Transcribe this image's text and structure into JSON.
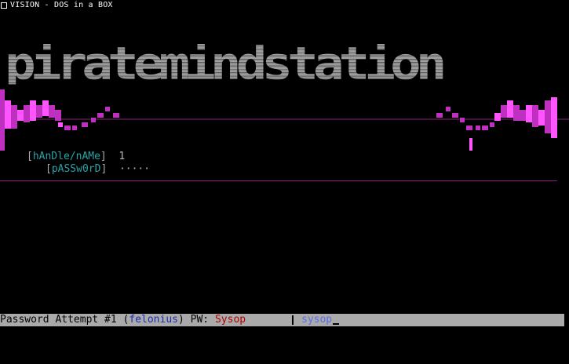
{
  "window": {
    "title": "VISION - DOS in a BOX",
    "icon": "window-menu-icon"
  },
  "logo": {
    "text": "piratemindstation",
    "color": "#8d8d8d"
  },
  "colors": {
    "magenta": "#c030c0",
    "pink": "#ff55ff",
    "cyan_label": "#2aa3a8",
    "separator": "#8a1f7c",
    "statusbar_bg": "#aaaaaa",
    "name_blue": "#1b2bb0",
    "pw_red": "#b00000",
    "typed_blue": "#5a6ee8"
  },
  "login": {
    "handle_label": "hAnDle/nAMe",
    "handle_value": "1",
    "password_label": "pASSw0rD",
    "password_value": "·····"
  },
  "statusbar": {
    "prefix": "Password Attempt #1 (",
    "name": "felonius",
    "mid": ") PW: ",
    "pw": "Sysop",
    "typed": "sysop"
  }
}
